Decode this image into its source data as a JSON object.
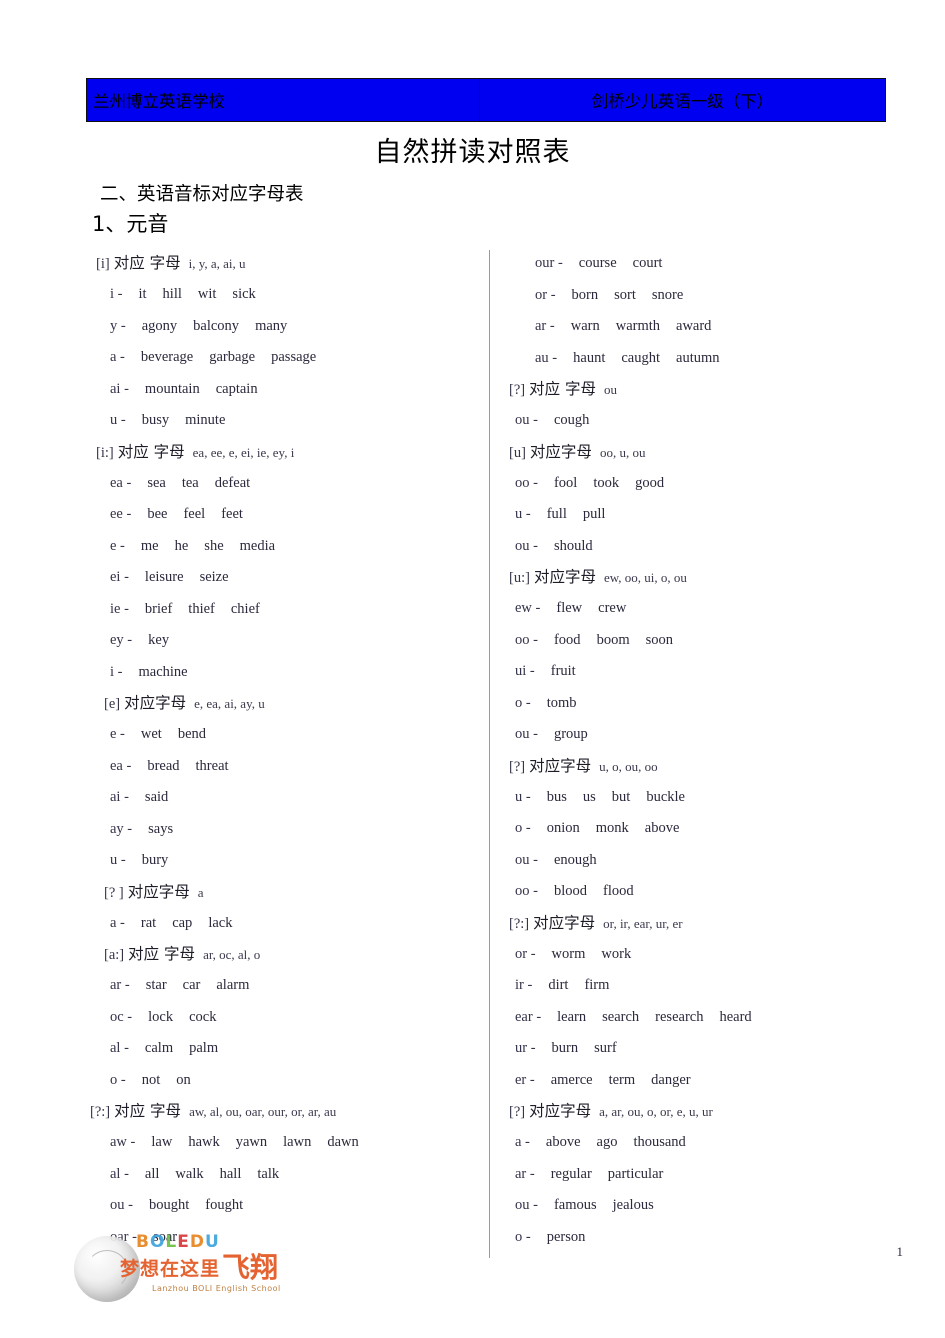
{
  "header": {
    "left_cell": "兰州博立英语学校",
    "right_cell": "剑桥少儿英语一级（下）",
    "bg_color": "#0000f0"
  },
  "title": "自然拼读对照表",
  "section_heading": "二、英语音标对应字母表",
  "subsection_heading": "1、元音",
  "label_correspond": "对应 字母",
  "left_column": [
    {
      "symbol": "[i]",
      "cn": "对应 字母",
      "letters": "i, y, a, ai, u",
      "indent": "ind-2",
      "rows": [
        {
          "lead": "i -",
          "words": [
            "it",
            "hill",
            "wit",
            "sick"
          ]
        },
        {
          "lead": "y -",
          "words": [
            "agony",
            "balcony",
            "many"
          ]
        },
        {
          "lead": "a -",
          "words": [
            "beverage",
            "garbage",
            "passage"
          ]
        },
        {
          "lead": "ai -",
          "words": [
            "mountain",
            "captain"
          ]
        },
        {
          "lead": "u -",
          "words": [
            "busy",
            "minute"
          ]
        }
      ]
    },
    {
      "symbol": "[i:]",
      "cn": "对应 字母",
      "letters": "ea, ee, e, ei, ie, ey, i",
      "indent": "ind-2",
      "rows": [
        {
          "lead": "ea -",
          "words": [
            "sea",
            "tea",
            "defeat"
          ]
        },
        {
          "lead": "ee -",
          "words": [
            "bee",
            "feel",
            "feet"
          ]
        },
        {
          "lead": "e -",
          "words": [
            "me",
            "he",
            "she",
            "media"
          ]
        },
        {
          "lead": "ei -",
          "words": [
            "leisure",
            "seize"
          ]
        },
        {
          "lead": "ie -",
          "words": [
            "brief",
            "thief",
            "chief"
          ]
        },
        {
          "lead": "ey -",
          "words": [
            "key"
          ]
        },
        {
          "lead": "i -",
          "words": [
            "machine"
          ]
        }
      ]
    },
    {
      "symbol": "[e]",
      "cn": "对应字母",
      "letters": "e, ea, ai, ay, u",
      "indent": "ind-3",
      "rows": [
        {
          "lead": "e -",
          "words": [
            "wet",
            "bend"
          ]
        },
        {
          "lead": "ea -",
          "words": [
            "bread",
            "threat"
          ]
        },
        {
          "lead": "ai -",
          "words": [
            "said"
          ]
        },
        {
          "lead": "ay -",
          "words": [
            "says"
          ]
        },
        {
          "lead": "u -",
          "words": [
            "bury"
          ]
        }
      ]
    },
    {
      "symbol": "[? ]",
      "cn": "对应字母",
      "letters": "a",
      "indent": "ind-3",
      "rows": [
        {
          "lead": "a -",
          "words": [
            "rat",
            "cap",
            "lack"
          ]
        }
      ]
    },
    {
      "symbol": "[a:]",
      "cn": "对应 字母",
      "letters": "ar, oc, al, o",
      "indent": "ind-3",
      "rows": [
        {
          "lead": "ar -",
          "words": [
            "star",
            "car",
            "alarm"
          ]
        },
        {
          "lead": "oc -",
          "words": [
            "lock",
            "cock"
          ]
        },
        {
          "lead": "al -",
          "words": [
            "calm",
            "palm"
          ]
        },
        {
          "lead": "o -",
          "words": [
            "not",
            "on"
          ]
        }
      ]
    },
    {
      "symbol": "[?:]",
      "cn": "对应 字母",
      "letters": "aw, al, ou, oar, our, or, ar, au",
      "indent": "ind-1",
      "rows": [
        {
          "lead": "aw -",
          "words": [
            "law",
            "hawk",
            "yawn",
            "lawn",
            "dawn"
          ]
        },
        {
          "lead": "al -",
          "words": [
            "all",
            "walk",
            "hall",
            "talk"
          ]
        },
        {
          "lead": "ou -",
          "words": [
            "bought",
            "fought"
          ]
        },
        {
          "lead": "oar -",
          "words": [
            "soar"
          ]
        }
      ]
    }
  ],
  "right_column": [
    {
      "symbol": "",
      "cn": "",
      "letters": "",
      "indent": "ind-2",
      "rows": [
        {
          "lead": "our -",
          "words": [
            "course",
            "court"
          ]
        },
        {
          "lead": "or -",
          "words": [
            "born",
            "sort",
            "snore"
          ]
        },
        {
          "lead": "ar -",
          "words": [
            "warn",
            "warmth",
            "award"
          ]
        },
        {
          "lead": "au -",
          "words": [
            "haunt",
            "caught",
            "autumn"
          ]
        }
      ]
    },
    {
      "symbol": "[?]",
      "cn": "对应 字母",
      "letters": "ou",
      "indent": "ind-0",
      "rows": [
        {
          "lead": "ou -",
          "words": [
            "cough"
          ]
        }
      ]
    },
    {
      "symbol": "[u]",
      "cn": "对应字母",
      "letters": "oo, u, ou",
      "indent": "ind-0",
      "rows": [
        {
          "lead": "oo -",
          "words": [
            "fool",
            "took",
            "good"
          ]
        },
        {
          "lead": "u -",
          "words": [
            "full",
            "pull"
          ]
        },
        {
          "lead": "ou -",
          "words": [
            "should"
          ]
        }
      ]
    },
    {
      "symbol": "[u:]",
      "cn": "对应字母",
      "letters": "ew, oo, ui, o, ou",
      "indent": "ind-0",
      "rows": [
        {
          "lead": "ew -",
          "words": [
            "flew",
            "crew"
          ]
        },
        {
          "lead": "oo -",
          "words": [
            "food",
            "boom",
            "soon"
          ]
        },
        {
          "lead": "ui  -",
          "words": [
            "fruit"
          ]
        },
        {
          "lead": "o -",
          "words": [
            "tomb"
          ]
        },
        {
          "lead": "ou -",
          "words": [
            "group"
          ]
        }
      ]
    },
    {
      "symbol": "[?]",
      "cn": "对应字母",
      "letters": "u, o, ou, oo",
      "indent": "ind-0",
      "rows": [
        {
          "lead": "u -",
          "words": [
            "bus",
            "us",
            "but",
            "buckle"
          ]
        },
        {
          "lead": "o -",
          "words": [
            "onion",
            "monk",
            "above"
          ]
        },
        {
          "lead": "ou -",
          "words": [
            "enough"
          ]
        },
        {
          "lead": "oo -",
          "words": [
            "blood",
            "flood"
          ]
        }
      ]
    },
    {
      "symbol": "[?:]",
      "cn": "对应字母",
      "letters": "or, ir, ear, ur, er",
      "indent": "ind-0",
      "rows": [
        {
          "lead": "or -",
          "words": [
            "worm",
            "work"
          ]
        },
        {
          "lead": "ir -",
          "words": [
            "dirt",
            "firm"
          ]
        },
        {
          "lead": "ear -",
          "words": [
            "learn",
            "search",
            "research",
            "heard"
          ]
        },
        {
          "lead": "ur -",
          "words": [
            "burn",
            "surf"
          ]
        },
        {
          "lead": "er -",
          "words": [
            "amerce",
            "term",
            "danger"
          ]
        }
      ]
    },
    {
      "symbol": "[?]",
      "cn": "对应字母",
      "letters": "a, ar, ou, o, or, e, u, ur",
      "indent": "ind-0",
      "rows": [
        {
          "lead": "a -",
          "words": [
            "above",
            "ago",
            "thousand"
          ]
        },
        {
          "lead": "ar -",
          "words": [
            "regular",
            "particular"
          ]
        },
        {
          "lead": "ou -",
          "words": [
            "famous",
            "jealous"
          ]
        },
        {
          "lead": "o -",
          "words": [
            "person"
          ]
        }
      ]
    }
  ],
  "logo": {
    "brand": "BOLEDU",
    "cn_tagline": "梦想在这里",
    "cn_fly": "飞翔",
    "en_tagline": "Lanzhou BOLI English School"
  },
  "page_number": "1"
}
